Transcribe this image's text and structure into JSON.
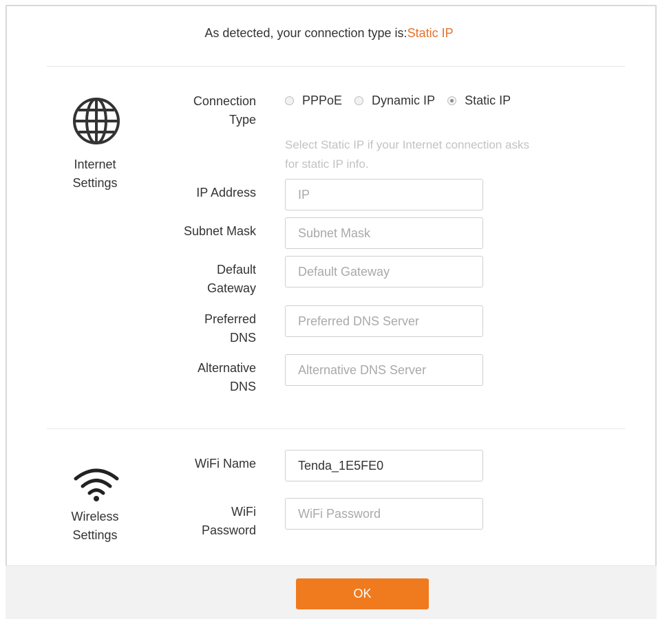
{
  "header": {
    "detected_prefix": "As detected, your connection type is:",
    "detected_value": "Static IP"
  },
  "internet": {
    "section_label_line1": "Internet",
    "section_label_line2": "Settings",
    "icon": "globe-icon",
    "connection_type_label_line1": "Connection",
    "connection_type_label_line2": "Type",
    "options": [
      "PPPoE",
      "Dynamic IP",
      "Static IP"
    ],
    "selected": "Static IP",
    "hint_line1": "Select Static IP if your Internet connection asks",
    "hint_line2": "for static IP info.",
    "fields": [
      {
        "label_line1": "IP Address",
        "label_line2": "",
        "value": "",
        "placeholder": "IP"
      },
      {
        "label_line1": "Subnet Mask",
        "label_line2": "",
        "value": "",
        "placeholder": "Subnet Mask"
      },
      {
        "label_line1": "Default",
        "label_line2": "Gateway",
        "value": "",
        "placeholder": "Default Gateway"
      },
      {
        "label_line1": "Preferred",
        "label_line2": "DNS",
        "value": "",
        "placeholder": "Preferred DNS Server"
      },
      {
        "label_line1": "Alternative",
        "label_line2": "DNS",
        "value": "",
        "placeholder": "Alternative DNS Server"
      }
    ]
  },
  "wireless": {
    "section_label_line1": "Wireless",
    "section_label_line2": "Settings",
    "icon": "wifi-icon",
    "wifi_name_label": "WiFi Name",
    "wifi_name_value": "Tenda_1E5FE0",
    "wifi_password_label_line1": "WiFi",
    "wifi_password_label_line2": "Password",
    "wifi_password_value": "",
    "wifi_password_placeholder": "WiFi Password"
  },
  "footer": {
    "ok_label": "OK"
  },
  "colors": {
    "accent": "#e2712a",
    "button": "#f07a1e"
  }
}
